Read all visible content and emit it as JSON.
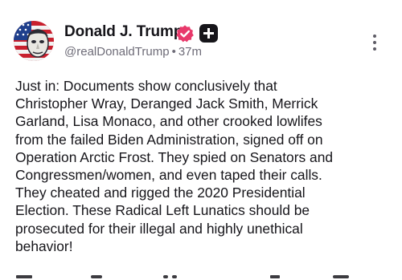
{
  "author": {
    "display_name": "Donald J. Trump",
    "handle": "@realDonaldTrump",
    "separator": "•",
    "time_ago": "37m"
  },
  "post": {
    "text": "Just in: Documents show conclusively that\nChristopher Wray, Deranged Jack Smith, Merrick\nGarland, Lisa Monaco, and other crooked lowlifes\nfrom the failed Biden Administration, signed off on\nOperation Arctic Frost. They spied on Senators and\nCongressmen/women, and even taped their calls.\nThey cheated and rigged the 2020 Presidential\nElection. These Radical Left Lunatics should be\nprosecuted for their illegal and highly unethical\nbehavior!"
  },
  "icons": {
    "verified": "verified-badge-icon",
    "plus": "plus-badge-icon",
    "more": "more-vertical-icon",
    "actions": [
      "reply-icon",
      "retruth-icon",
      "like-icon",
      "share-icon",
      "bookmark-icon"
    ]
  },
  "colors": {
    "verified_badge": "#e8396b",
    "text_primary": "#16151a",
    "text_secondary": "#6e6c78"
  }
}
